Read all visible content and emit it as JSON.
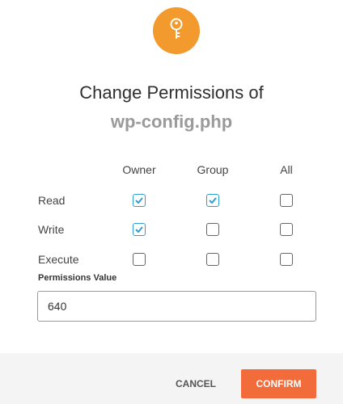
{
  "dialog": {
    "icon": "key-icon",
    "accent_color": "#f29a2e",
    "title": "Change Permissions of",
    "filename": "wp-config.php"
  },
  "permissions": {
    "columns": [
      "Owner",
      "Group",
      "All"
    ],
    "rows": [
      {
        "label": "Read",
        "checked": [
          true,
          true,
          false
        ]
      },
      {
        "label": "Write",
        "checked": [
          true,
          false,
          false
        ]
      },
      {
        "label": "Execute",
        "checked": [
          false,
          false,
          false
        ]
      }
    ],
    "check_color": "#2e9fd1"
  },
  "permissions_value": {
    "label": "Permissions Value",
    "value": "640"
  },
  "footer": {
    "cancel_label": "CANCEL",
    "confirm_label": "CONFIRM",
    "confirm_color": "#f26b3a"
  }
}
